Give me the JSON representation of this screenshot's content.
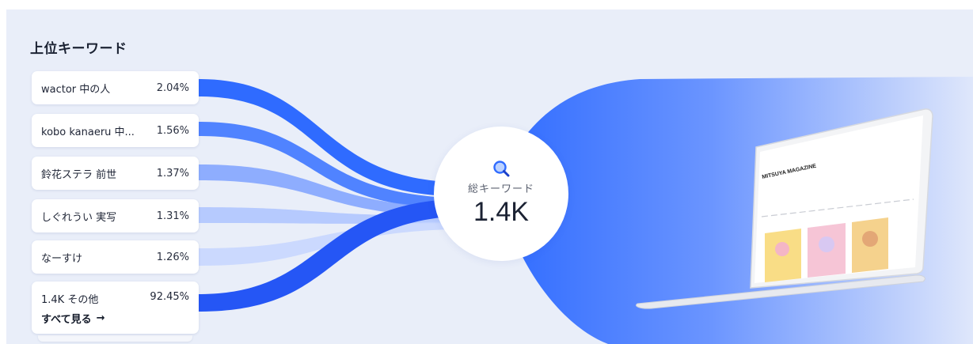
{
  "section": {
    "title": "上位キーワード"
  },
  "keywords": [
    {
      "name": "wactor 中の人",
      "percent": "2.04%"
    },
    {
      "name": "kobo kanaeru 中...",
      "percent": "1.56%"
    },
    {
      "name": "鈴花ステラ 前世",
      "percent": "1.37%"
    },
    {
      "name": "しぐれうい 実写",
      "percent": "1.31%"
    },
    {
      "name": "なーすけ",
      "percent": "1.26%"
    }
  ],
  "other": {
    "name": "1.4K その他",
    "percent": "92.45%",
    "see_all": "すべて見る",
    "arrow": "→"
  },
  "hub": {
    "icon": "search-icon",
    "label": "総キーワード",
    "value": "1.4K"
  },
  "preview": {
    "site_title": "MITSUYA MAGAZINE"
  },
  "colors": {
    "flow": "#2f6bff",
    "flow_light": "#9db8ff",
    "panel": "#e9eef9"
  }
}
